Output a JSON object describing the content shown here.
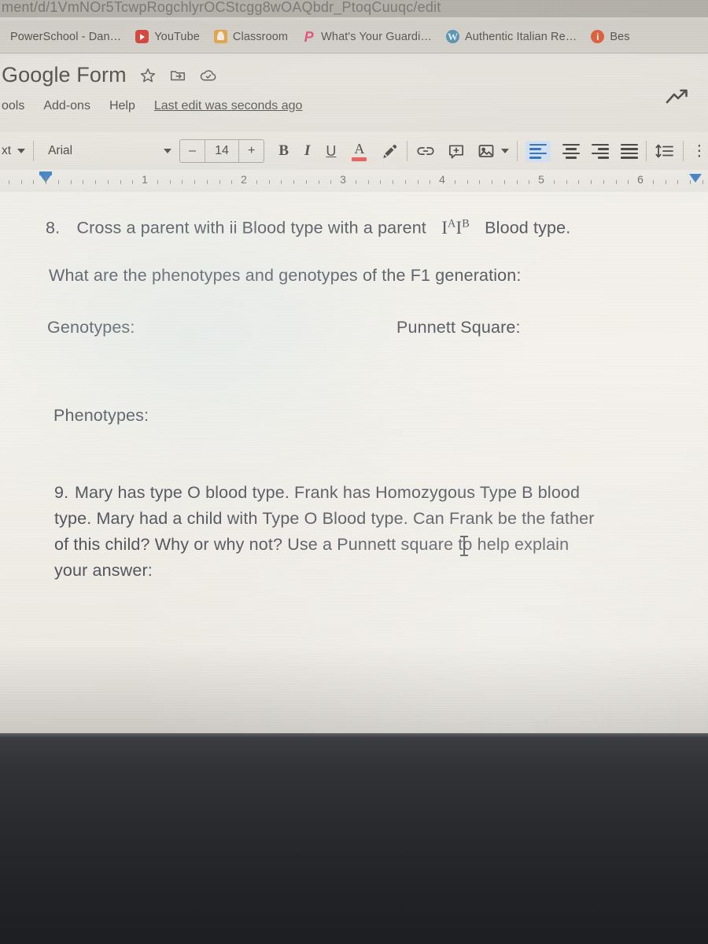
{
  "browser": {
    "url": "ment/d/1VmNOr5TcwpRogchlyrOCStcgg8wOAQbdr_PtoqCuuqc/edit",
    "bookmarks": [
      {
        "label": "PowerSchool - Dan…",
        "icon": "none"
      },
      {
        "label": "YouTube",
        "icon": "youtube-icon"
      },
      {
        "label": "Classroom",
        "icon": "classroom-icon"
      },
      {
        "label": "What's Your Guardi…",
        "icon": "pinterest-icon"
      },
      {
        "label": "Authentic Italian Re…",
        "icon": "wordpress-icon"
      },
      {
        "label": "Bes",
        "icon": "info-icon"
      }
    ]
  },
  "docs": {
    "title": "Google Form",
    "star_icon": "star-icon",
    "move_icon": "move-to-folder-icon",
    "cloud_icon": "cloud-saved-icon",
    "trend_icon": "explore-trend-icon",
    "menu": [
      {
        "label": "ools"
      },
      {
        "label": "Add-ons"
      },
      {
        "label": "Help"
      }
    ],
    "last_edit": "Last edit was seconds ago"
  },
  "toolbar": {
    "style_select": "xt",
    "font_select": "Arial",
    "font_size_decrease": "–",
    "font_size": "14",
    "font_size_increase": "+",
    "bold": "B",
    "italic": "I",
    "underline": "U",
    "text_color": "A",
    "text_color_swatch": "#e8564f",
    "highlight_icon": "highlight-pen-icon",
    "link_icon": "insert-link-icon",
    "comment_icon": "add-comment-icon",
    "image_icon": "insert-image-icon",
    "align_left_icon": "align-left-icon",
    "align_center_icon": "align-center-icon",
    "align_right_icon": "align-right-icon",
    "align_justify_icon": "align-justify-icon",
    "line_spacing_icon": "line-spacing-icon",
    "more_icon": "more-options-icon",
    "active_align": "align-left-icon",
    "active_align_color": "#2d6bb5"
  },
  "ruler": {
    "numbers": [
      "1",
      "2",
      "3",
      "4",
      "5",
      "6"
    ],
    "unit": "inches"
  },
  "document": {
    "q8": {
      "number": "8.",
      "text_before": "Cross a parent with ii Blood type with a parent",
      "allele_i1": "I",
      "allele_sup1": "A",
      "allele_i2": "I",
      "allele_sup2": "B",
      "text_after": "Blood type."
    },
    "prompt": "What are the phenotypes and genotypes of the F1 generation:",
    "genotypes_label": "Genotypes:",
    "punnett_label": "Punnett Square:",
    "phenotypes_label": "Phenotypes:",
    "q9": {
      "number": "9.",
      "line1": "Mary has type O blood type.  Frank has Homozygous Type B blood",
      "line2": "type.  Mary had a child with Type O Blood type.  Can Frank be the father",
      "line3": "of this child?  Why or why not?  Use a Punnett square to help explain",
      "line4": "your answer:"
    }
  }
}
